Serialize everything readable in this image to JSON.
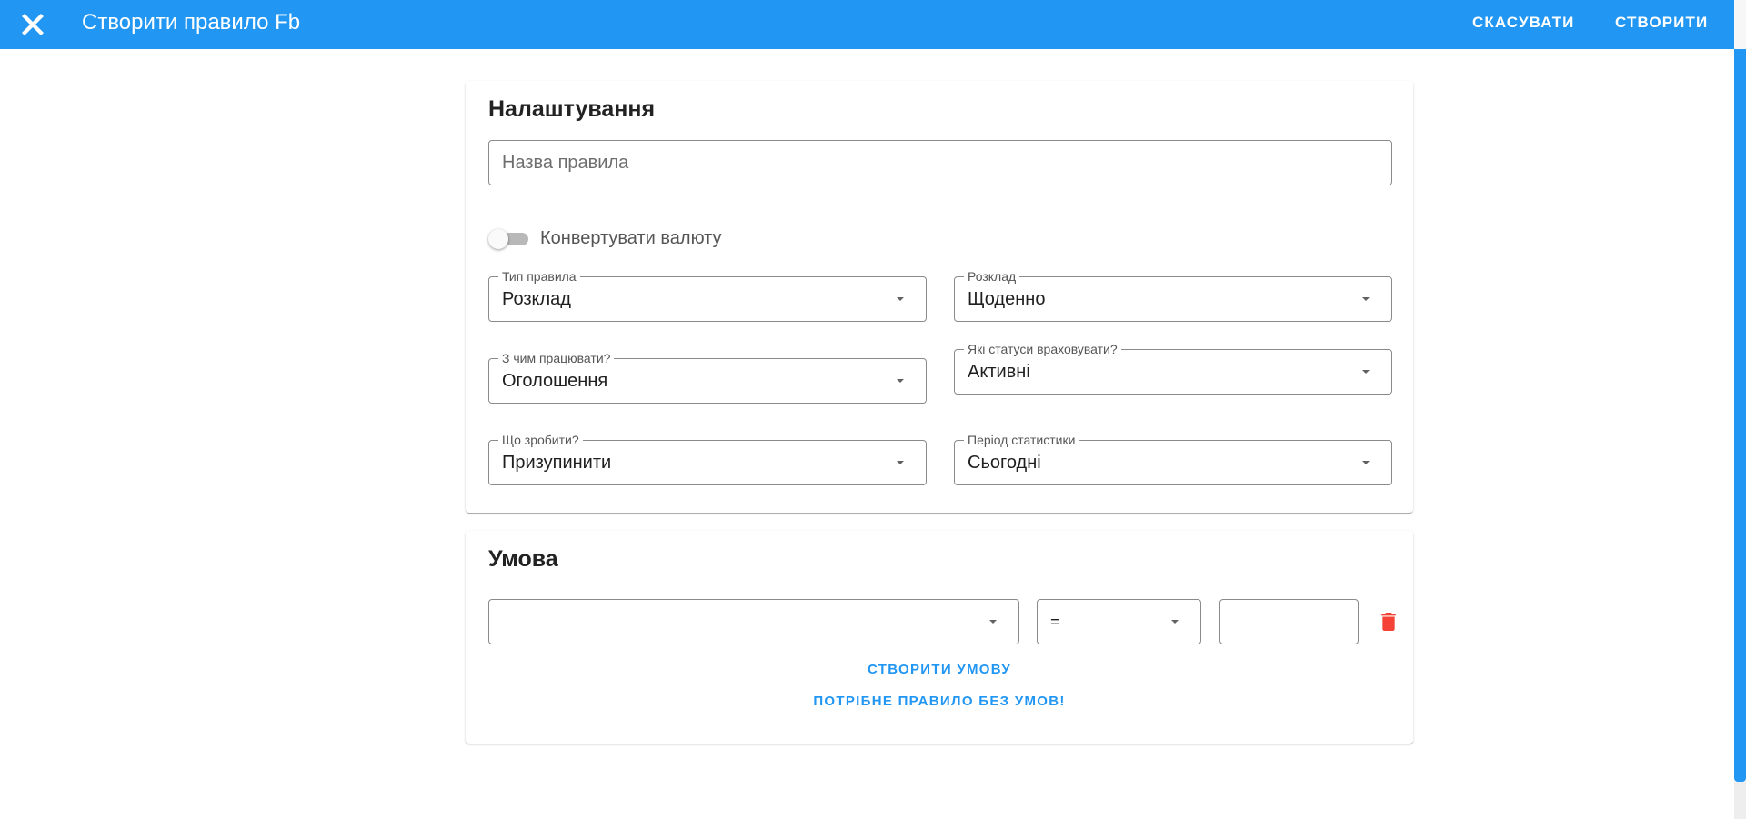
{
  "header": {
    "title": "Створити правило Fb",
    "cancel_label": "СКАСУВАТИ",
    "create_label": "СТВОРИТИ",
    "close_icon": "close-icon",
    "color": "#2196f3"
  },
  "settings": {
    "title": "Налаштування",
    "rule_name_placeholder": "Назва правила",
    "rule_name_value": "",
    "convert_currency": {
      "label": "Конвертувати валюту",
      "enabled": false
    },
    "rule_type": {
      "label": "Тип правила",
      "value": "Розклад"
    },
    "schedule": {
      "label": "Розклад",
      "value": "Щоденно"
    },
    "work_with": {
      "label": "З чим працювати?",
      "value": "Оголошення"
    },
    "statuses": {
      "label": "Які статуси враховувати?",
      "value": "Активні"
    },
    "action": {
      "label": "Що зробити?",
      "value": "Призупинити"
    },
    "period": {
      "label": "Період статистики",
      "value": "Сьогодні"
    }
  },
  "condition": {
    "title": "Умова",
    "metric_value": "",
    "operator_value": "=",
    "amount_value": "",
    "delete_icon": "trash-icon",
    "delete_color": "#f44336",
    "create_condition_label": "СТВОРИТИ УМОВУ",
    "no_conditions_label": "ПОТРІБНЕ ПРАВИЛО БЕЗ УМОВ!"
  }
}
